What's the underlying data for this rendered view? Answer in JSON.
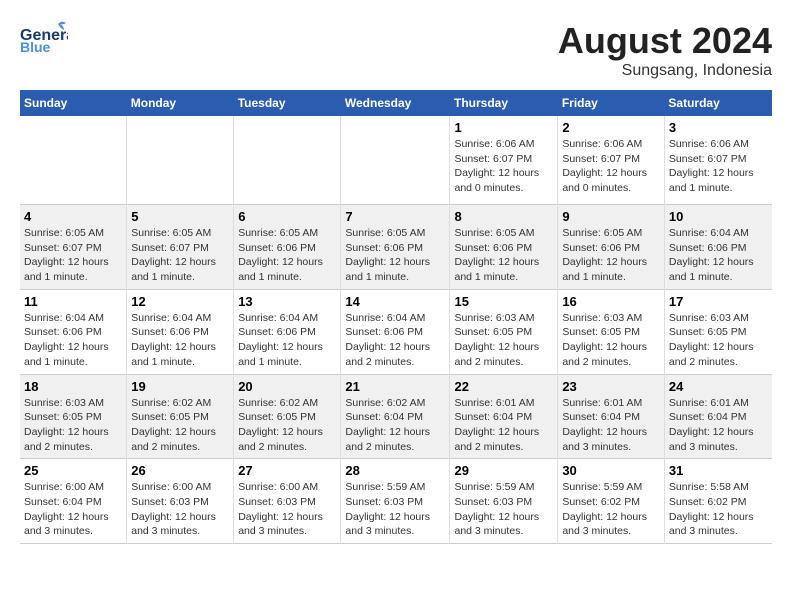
{
  "header": {
    "logo_general": "General",
    "logo_blue": "Blue",
    "month_year": "August 2024",
    "location": "Sungsang, Indonesia"
  },
  "days_of_week": [
    "Sunday",
    "Monday",
    "Tuesday",
    "Wednesday",
    "Thursday",
    "Friday",
    "Saturday"
  ],
  "weeks": [
    [
      {
        "day": "",
        "info": ""
      },
      {
        "day": "",
        "info": ""
      },
      {
        "day": "",
        "info": ""
      },
      {
        "day": "",
        "info": ""
      },
      {
        "day": "1",
        "info": "Sunrise: 6:06 AM\nSunset: 6:07 PM\nDaylight: 12 hours and 0 minutes."
      },
      {
        "day": "2",
        "info": "Sunrise: 6:06 AM\nSunset: 6:07 PM\nDaylight: 12 hours and 0 minutes."
      },
      {
        "day": "3",
        "info": "Sunrise: 6:06 AM\nSunset: 6:07 PM\nDaylight: 12 hours and 1 minute."
      }
    ],
    [
      {
        "day": "4",
        "info": "Sunrise: 6:05 AM\nSunset: 6:07 PM\nDaylight: 12 hours and 1 minute."
      },
      {
        "day": "5",
        "info": "Sunrise: 6:05 AM\nSunset: 6:07 PM\nDaylight: 12 hours and 1 minute."
      },
      {
        "day": "6",
        "info": "Sunrise: 6:05 AM\nSunset: 6:06 PM\nDaylight: 12 hours and 1 minute."
      },
      {
        "day": "7",
        "info": "Sunrise: 6:05 AM\nSunset: 6:06 PM\nDaylight: 12 hours and 1 minute."
      },
      {
        "day": "8",
        "info": "Sunrise: 6:05 AM\nSunset: 6:06 PM\nDaylight: 12 hours and 1 minute."
      },
      {
        "day": "9",
        "info": "Sunrise: 6:05 AM\nSunset: 6:06 PM\nDaylight: 12 hours and 1 minute."
      },
      {
        "day": "10",
        "info": "Sunrise: 6:04 AM\nSunset: 6:06 PM\nDaylight: 12 hours and 1 minute."
      }
    ],
    [
      {
        "day": "11",
        "info": "Sunrise: 6:04 AM\nSunset: 6:06 PM\nDaylight: 12 hours and 1 minute."
      },
      {
        "day": "12",
        "info": "Sunrise: 6:04 AM\nSunset: 6:06 PM\nDaylight: 12 hours and 1 minute."
      },
      {
        "day": "13",
        "info": "Sunrise: 6:04 AM\nSunset: 6:06 PM\nDaylight: 12 hours and 1 minute."
      },
      {
        "day": "14",
        "info": "Sunrise: 6:04 AM\nSunset: 6:06 PM\nDaylight: 12 hours and 2 minutes."
      },
      {
        "day": "15",
        "info": "Sunrise: 6:03 AM\nSunset: 6:05 PM\nDaylight: 12 hours and 2 minutes."
      },
      {
        "day": "16",
        "info": "Sunrise: 6:03 AM\nSunset: 6:05 PM\nDaylight: 12 hours and 2 minutes."
      },
      {
        "day": "17",
        "info": "Sunrise: 6:03 AM\nSunset: 6:05 PM\nDaylight: 12 hours and 2 minutes."
      }
    ],
    [
      {
        "day": "18",
        "info": "Sunrise: 6:03 AM\nSunset: 6:05 PM\nDaylight: 12 hours and 2 minutes."
      },
      {
        "day": "19",
        "info": "Sunrise: 6:02 AM\nSunset: 6:05 PM\nDaylight: 12 hours and 2 minutes."
      },
      {
        "day": "20",
        "info": "Sunrise: 6:02 AM\nSunset: 6:05 PM\nDaylight: 12 hours and 2 minutes."
      },
      {
        "day": "21",
        "info": "Sunrise: 6:02 AM\nSunset: 6:04 PM\nDaylight: 12 hours and 2 minutes."
      },
      {
        "day": "22",
        "info": "Sunrise: 6:01 AM\nSunset: 6:04 PM\nDaylight: 12 hours and 2 minutes."
      },
      {
        "day": "23",
        "info": "Sunrise: 6:01 AM\nSunset: 6:04 PM\nDaylight: 12 hours and 3 minutes."
      },
      {
        "day": "24",
        "info": "Sunrise: 6:01 AM\nSunset: 6:04 PM\nDaylight: 12 hours and 3 minutes."
      }
    ],
    [
      {
        "day": "25",
        "info": "Sunrise: 6:00 AM\nSunset: 6:04 PM\nDaylight: 12 hours and 3 minutes."
      },
      {
        "day": "26",
        "info": "Sunrise: 6:00 AM\nSunset: 6:03 PM\nDaylight: 12 hours and 3 minutes."
      },
      {
        "day": "27",
        "info": "Sunrise: 6:00 AM\nSunset: 6:03 PM\nDaylight: 12 hours and 3 minutes."
      },
      {
        "day": "28",
        "info": "Sunrise: 5:59 AM\nSunset: 6:03 PM\nDaylight: 12 hours and 3 minutes."
      },
      {
        "day": "29",
        "info": "Sunrise: 5:59 AM\nSunset: 6:03 PM\nDaylight: 12 hours and 3 minutes."
      },
      {
        "day": "30",
        "info": "Sunrise: 5:59 AM\nSunset: 6:02 PM\nDaylight: 12 hours and 3 minutes."
      },
      {
        "day": "31",
        "info": "Sunrise: 5:58 AM\nSunset: 6:02 PM\nDaylight: 12 hours and 3 minutes."
      }
    ]
  ]
}
